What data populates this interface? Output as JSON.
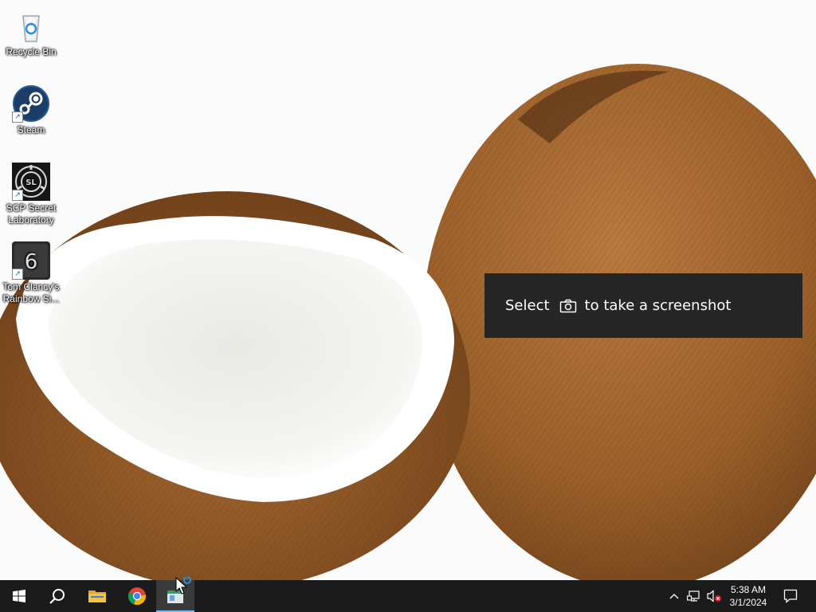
{
  "desktop": {
    "icons": [
      {
        "label": "Recycle Bin",
        "icon": "recycle-bin-icon"
      },
      {
        "label": "Steam",
        "icon": "steam-icon"
      },
      {
        "label": "SCP Secret Laboratory",
        "icon": "scp-sl-icon"
      },
      {
        "label": "Tom Clancy's Rainbow Si...",
        "icon": "rainbow-six-icon"
      }
    ]
  },
  "toast": {
    "prefix": "Select",
    "suffix": "to take a screenshot",
    "icon": "camera-icon"
  },
  "taskbar": {
    "apps": [
      {
        "name": "start",
        "icon": "windows-logo-icon"
      },
      {
        "name": "search",
        "icon": "search-icon"
      },
      {
        "name": "file-explorer",
        "icon": "folder-icon"
      },
      {
        "name": "chrome",
        "icon": "chrome-icon"
      },
      {
        "name": "snipping-tool",
        "icon": "snipping-tool-icon",
        "active": true
      }
    ],
    "tray": {
      "icons": [
        "chevron-up-icon",
        "network-icon",
        "volume-muted-icon"
      ],
      "time": "5:38 AM",
      "date": "3/1/2024",
      "notification_icon": "notification-icon"
    },
    "accent": "#76b9ed"
  }
}
